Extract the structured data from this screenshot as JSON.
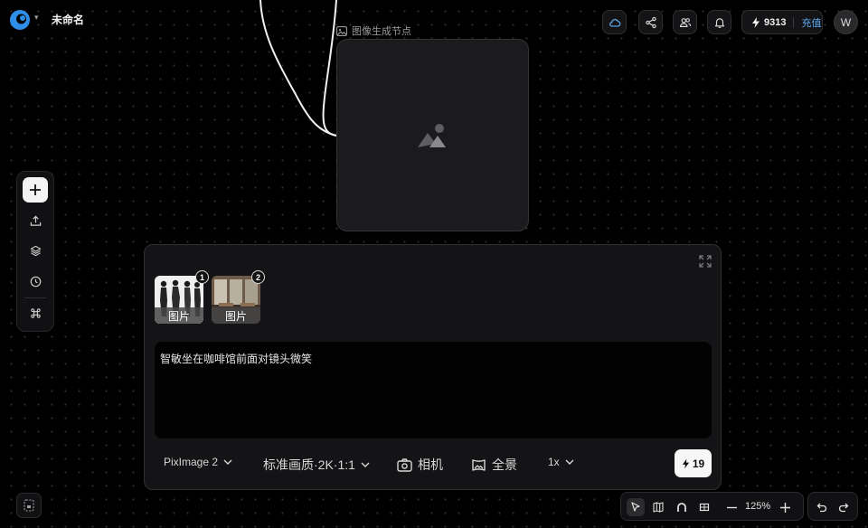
{
  "header": {
    "project_title": "未命名",
    "credits": "9313",
    "recharge_label": "充值",
    "avatar_initial": "W"
  },
  "node": {
    "label": "图像生成节点"
  },
  "panel": {
    "references": [
      {
        "label": "图片",
        "badge": "1"
      },
      {
        "label": "图片",
        "badge": "2"
      }
    ],
    "prompt": "智敏坐在咖啡馆前面对镜头微笑",
    "model": "PixImage 2",
    "quality": "标准画质·2K·1:1",
    "camera_label": "相机",
    "panorama_label": "全景",
    "count": "1x",
    "cost": "19"
  },
  "canvas_controls": {
    "zoom": "125%"
  },
  "colors": {
    "accent": "#5aa8f0",
    "background": "#000000",
    "panel": "#141416"
  }
}
